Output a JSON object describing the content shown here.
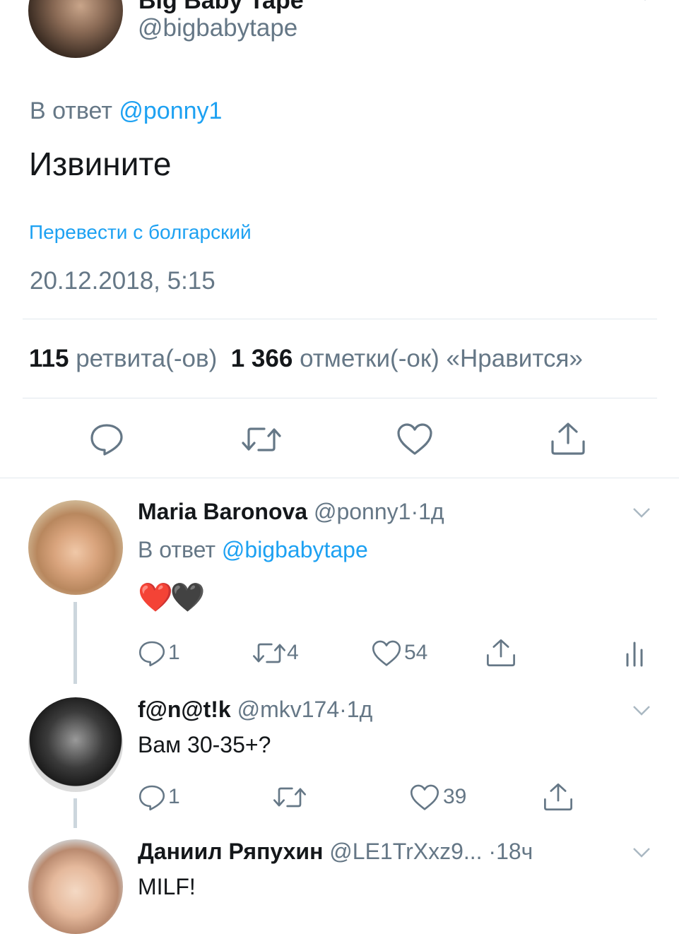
{
  "main_tweet": {
    "author_name": "Big Baby Tape",
    "handle": "@bigbabytape",
    "reply_prefix": "В ответ",
    "reply_to": "@ponny1",
    "text": "Извините",
    "translate_link": "Перевести с болгарский",
    "timestamp": "20.12.2018, 5:15",
    "retweets_count": "115",
    "retweets_label": "ретвита(-ов)",
    "likes_count": "1 366",
    "likes_label": "отметки(-ок) «Нравится»"
  },
  "replies": [
    {
      "name": "Maria Baronova",
      "handle": "@ponny1",
      "dot": "·",
      "time": "1д",
      "reply_prefix": "В ответ",
      "reply_to": "@bigbabytape",
      "text": "❤️🖤",
      "reply_count": "1",
      "retweet_count": "4",
      "like_count": "54"
    },
    {
      "name": "f@n@t!k",
      "handle": "@mkv174",
      "dot": "·",
      "time": "1д",
      "text": "Вам 30-35+?",
      "reply_count": "1",
      "retweet_count": "",
      "like_count": "39"
    },
    {
      "name": "Даниил Ряпухин",
      "handle": "@LE1TrXxz9...",
      "dot": "·",
      "time": "18ч",
      "text": "MILF!"
    }
  ],
  "icons": {
    "reply": "reply-icon",
    "retweet": "retweet-icon",
    "like": "heart-icon",
    "share": "share-icon",
    "analytics": "analytics-icon",
    "chevron": "chevron-down-icon"
  },
  "colors": {
    "link_blue": "#1da1f2",
    "secondary_gray": "#657786",
    "icon_gray": "#657786",
    "divider": "#e1e8ed",
    "thread_line": "#ccd6dd"
  }
}
